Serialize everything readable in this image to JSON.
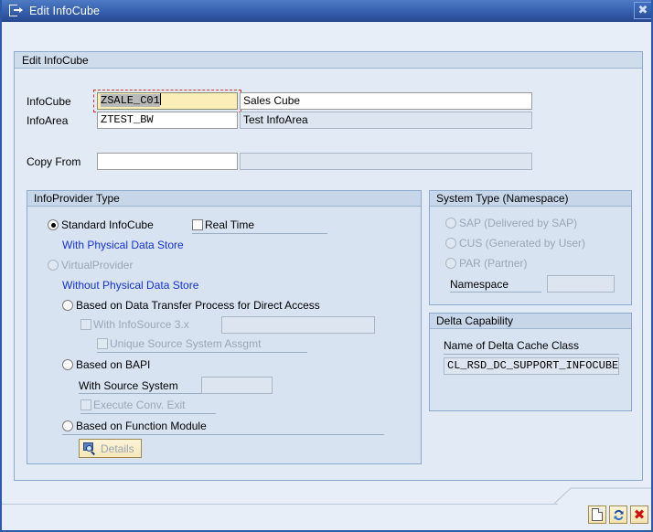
{
  "window": {
    "title": "Edit InfoCube",
    "title_icon": "dialog-window-icon",
    "close_label": "✖"
  },
  "outer_group": {
    "title": "Edit InfoCube"
  },
  "form": {
    "infocube": {
      "label": "InfoCube",
      "value": "ZSALE_C01",
      "description_value": "Sales Cube",
      "focused": true
    },
    "infoarea": {
      "label": "InfoArea",
      "value": "ZTEST_BW",
      "description_value": "Test InfoArea"
    },
    "copy_from": {
      "label": "Copy From",
      "value": "",
      "description_value": ""
    }
  },
  "infoprovider_type": {
    "title": "InfoProvider Type",
    "standard_infocube": {
      "label": "Standard InfoCube",
      "selected": true
    },
    "real_time": {
      "label": "Real Time",
      "checked": false
    },
    "hint_with_physical": "With Physical Data Store",
    "virtualprovider": {
      "label": "VirtualProvider",
      "selected": false,
      "disabled": true
    },
    "hint_without_physical": "Without Physical Data Store",
    "based_on_dtp": {
      "label": "Based on Data Transfer Process for Direct Access",
      "selected": false
    },
    "with_infosource": {
      "label": "With InfoSource 3.x",
      "checked": false,
      "disabled": true,
      "value": ""
    },
    "unique_source_system": {
      "label": "Unique Source System Assgmt",
      "checked": false,
      "disabled": true
    },
    "based_on_bapi": {
      "label": "Based on BAPI",
      "selected": false
    },
    "with_source_system": {
      "label": "With Source System",
      "value": ""
    },
    "execute_conv_exit": {
      "label": "Execute Conv. Exit",
      "checked": false,
      "disabled": true
    },
    "based_on_function_module": {
      "label": "Based on Function Module",
      "selected": false
    },
    "details_button": {
      "label": "Details",
      "icon": "magnifier-icon",
      "disabled": true
    }
  },
  "system_type": {
    "title": "System Type (Namespace)",
    "options": [
      {
        "label": "SAP (Delivered by SAP)",
        "selected": false,
        "disabled": true
      },
      {
        "label": "CUS (Generated by User)",
        "selected": false,
        "disabled": true
      },
      {
        "label": "PAR (Partner)",
        "selected": false,
        "disabled": true
      }
    ],
    "namespace": {
      "label": "Namespace",
      "value": ""
    }
  },
  "delta_capability": {
    "title": "Delta Capability",
    "cache_class": {
      "label": "Name of Delta Cache Class",
      "value": "CL_RSD_DC_SUPPORT_INFOCUBE"
    }
  },
  "toolbar": {
    "buttons": [
      {
        "name": "new-document-button",
        "icon": "page-icon",
        "label": ""
      },
      {
        "name": "transfer-button",
        "icon": "refresh-icon",
        "label": ""
      },
      {
        "name": "cancel-button",
        "icon": "red-x-icon",
        "label": "✖"
      }
    ]
  },
  "colors": {
    "titlebar": "#2e54a0",
    "window_bg": "#e8eef7",
    "group_bg": "#d8e3f1",
    "hint_text": "#1431d6",
    "focus_field": "#fbeeb9",
    "focus_border": "#e03030"
  }
}
